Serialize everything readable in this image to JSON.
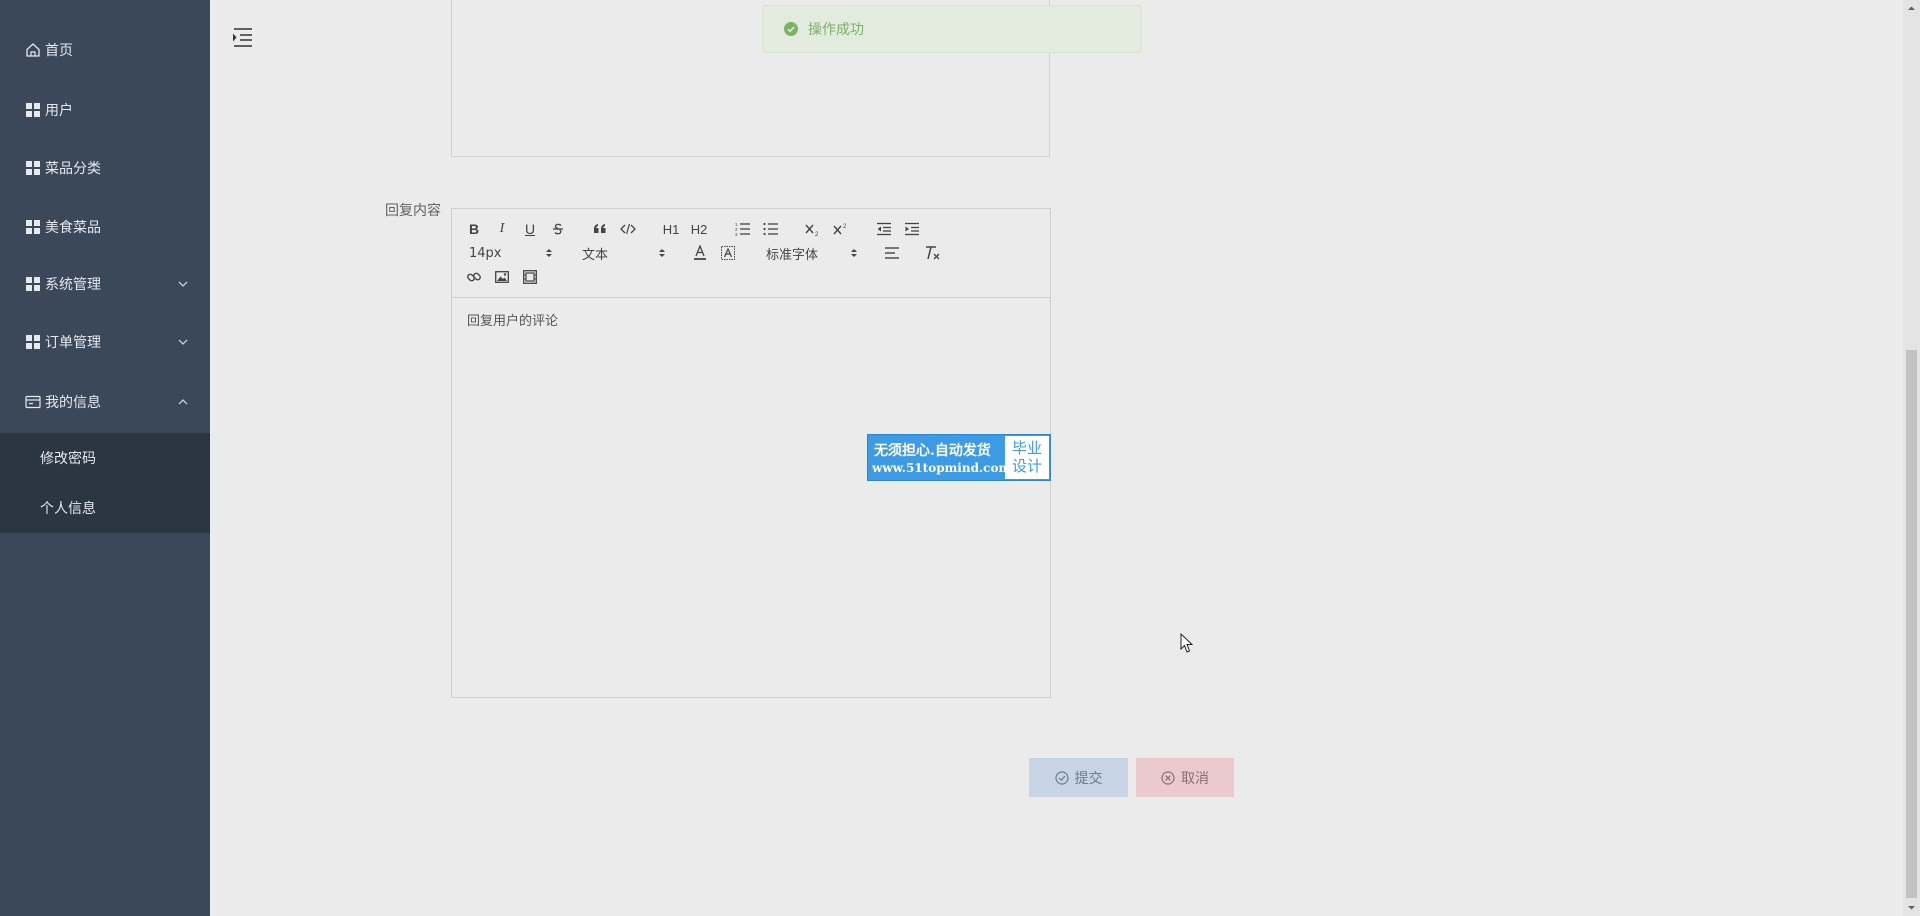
{
  "sidebar": {
    "items": [
      {
        "label": "首页",
        "icon": "home-icon"
      },
      {
        "label": "用户",
        "icon": "grid-icon"
      },
      {
        "label": "菜品分类",
        "icon": "grid-icon"
      },
      {
        "label": "美食菜品",
        "icon": "grid-icon"
      },
      {
        "label": "系统管理",
        "icon": "grid-icon",
        "expanded": false
      },
      {
        "label": "订单管理",
        "icon": "grid-icon",
        "expanded": false
      },
      {
        "label": "我的信息",
        "icon": "card-icon",
        "expanded": true
      }
    ],
    "submenu": [
      {
        "label": "修改密码"
      },
      {
        "label": "个人信息"
      }
    ]
  },
  "form": {
    "reply_label": "回复内容",
    "editor_placeholder": "回复用户的评论",
    "submit_label": "提交",
    "cancel_label": "取消"
  },
  "toolbar": {
    "font_size": "14px",
    "header_select": "文本",
    "font_family": "标准字体",
    "buttons": [
      "bold-icon",
      "italic-icon",
      "underline-icon",
      "strike-icon",
      "blockquote-icon",
      "code-block-icon",
      "h1-icon",
      "h2-icon",
      "ordered-list-icon",
      "bullet-list-icon",
      "subscript-icon",
      "superscript-icon",
      "outdent-icon",
      "indent-icon",
      "font-color-icon",
      "background-color-icon",
      "align-icon",
      "clear-format-icon",
      "link-icon",
      "image-icon",
      "video-icon"
    ],
    "labels": {
      "bold": "B",
      "italic": "I",
      "underline": "U",
      "h1": "H1",
      "h2": "H2"
    }
  },
  "toast": {
    "message": "操作成功",
    "type": "success"
  },
  "watermark": {
    "line1": "无须担心.自动发货",
    "line2": "www.51topmind.com",
    "badge": "毕业\n设计"
  },
  "colors": {
    "sidebar_bg": "#3b4859",
    "submenu_bg": "#2b3643",
    "page_bg": "#ebebeb",
    "submit_bg": "#c7d4e6",
    "cancel_bg": "#ecc9cd",
    "toast_bg": "#e3ebdf",
    "toast_text": "#7ab266",
    "watermark_blue": "#3d9be6"
  }
}
